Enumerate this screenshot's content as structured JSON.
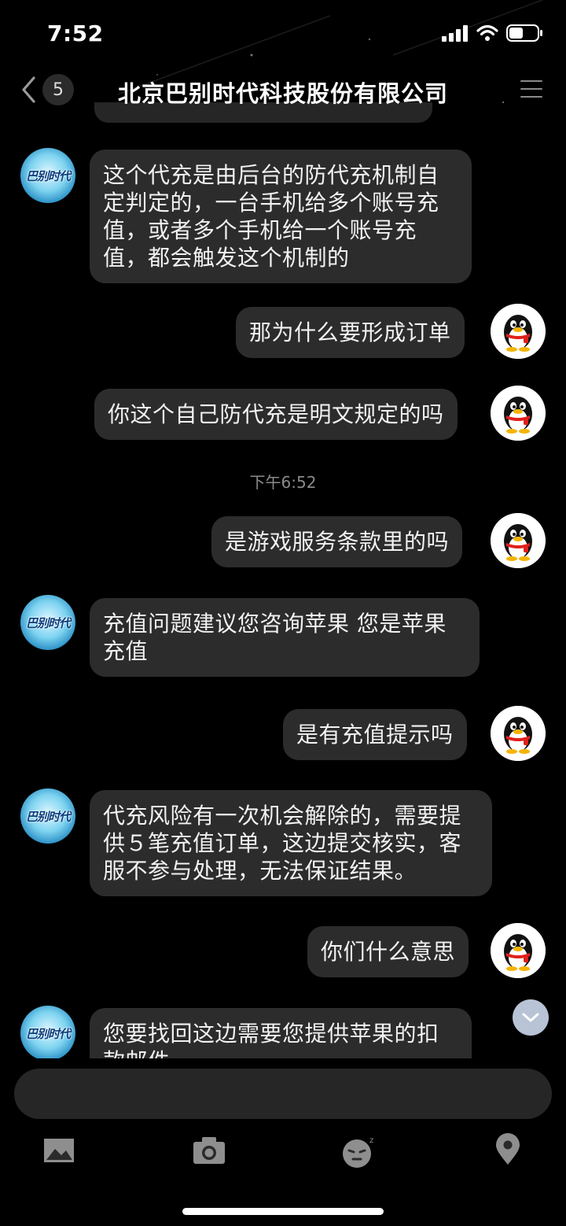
{
  "status_bar": {
    "time": "7:52",
    "battery_level": 0.5
  },
  "nav": {
    "back_count": "5",
    "title": "北京巴别时代科技股份有限公司"
  },
  "agent": {
    "avatar_text": "巴别时代"
  },
  "messages": [
    {
      "id": "m1",
      "side": "left",
      "text": "这个代充是由后台的防代充机制自定判定的，一台手机给多个账号充值，或者多个手机给一个账号充值，都会触发这个机制的"
    },
    {
      "id": "m2",
      "side": "right",
      "text": "那为什么要形成订单"
    },
    {
      "id": "m3",
      "side": "right",
      "text": "你这个自己防代充是明文规定的吗"
    },
    {
      "id": "ts1",
      "type": "timestamp",
      "text": "下午6:52"
    },
    {
      "id": "m4",
      "side": "right",
      "text": "是游戏服务条款里的吗"
    },
    {
      "id": "m5",
      "side": "left",
      "text": "充值问题建议您咨询苹果 您是苹果充值"
    },
    {
      "id": "m6",
      "side": "right",
      "text": "是有充值提示吗"
    },
    {
      "id": "m7",
      "side": "left",
      "text": "代充风险有一次机会解除的，需要提供５笔充值订单，这边提交核实，客服不参与处理，无法保证结果。"
    },
    {
      "id": "m8",
      "side": "right",
      "text": "你们什么意思"
    },
    {
      "id": "m9",
      "side": "left",
      "text": "您要找回这边需要您提供苹果的扣款邮件"
    }
  ],
  "toolbar": {
    "items": [
      {
        "icon": "image-icon"
      },
      {
        "icon": "camera-icon"
      },
      {
        "icon": "emoji-icon"
      },
      {
        "icon": "location-icon"
      }
    ]
  },
  "colors": {
    "bubble": "#2c2c2c",
    "background": "#000000",
    "scroll_button": "#b8c3d6"
  }
}
